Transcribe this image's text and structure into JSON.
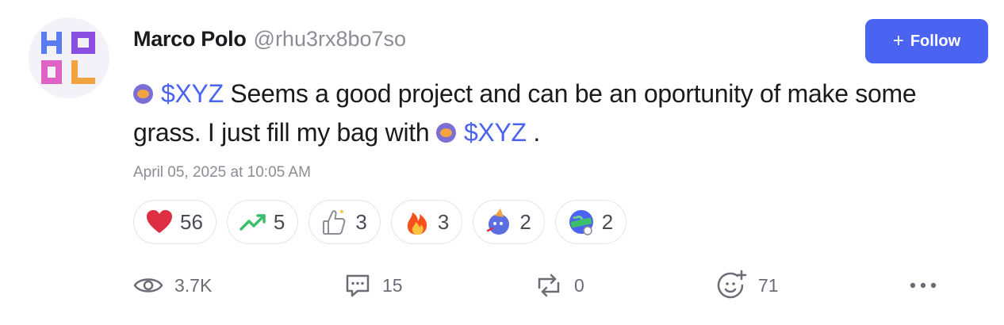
{
  "user": {
    "name": "Marco Polo",
    "handle": "@rhu3rx8bo7so"
  },
  "follow": {
    "label": "Follow"
  },
  "post": {
    "token": "$XYZ",
    "text_1": " Seems a good project and can be an oportunity of make some grass. I just fill my bag with ",
    "text_2": " ."
  },
  "timestamp": "April 05, 2025 at 10:05 AM",
  "reactions": [
    {
      "icon": "heart-icon",
      "count": "56"
    },
    {
      "icon": "trending-up-icon",
      "count": "5"
    },
    {
      "icon": "thumbs-up-icon",
      "count": "3"
    },
    {
      "icon": "fire-icon",
      "count": "3"
    },
    {
      "icon": "party-blob-icon",
      "count": "2"
    },
    {
      "icon": "hodl-globe-icon",
      "count": "2"
    }
  ],
  "actions": {
    "views": "3.7K",
    "comments": "15",
    "reposts": "0",
    "reactions_total": "71"
  },
  "colors": {
    "accent": "#4a63f0",
    "muted": "#8c8c95"
  }
}
